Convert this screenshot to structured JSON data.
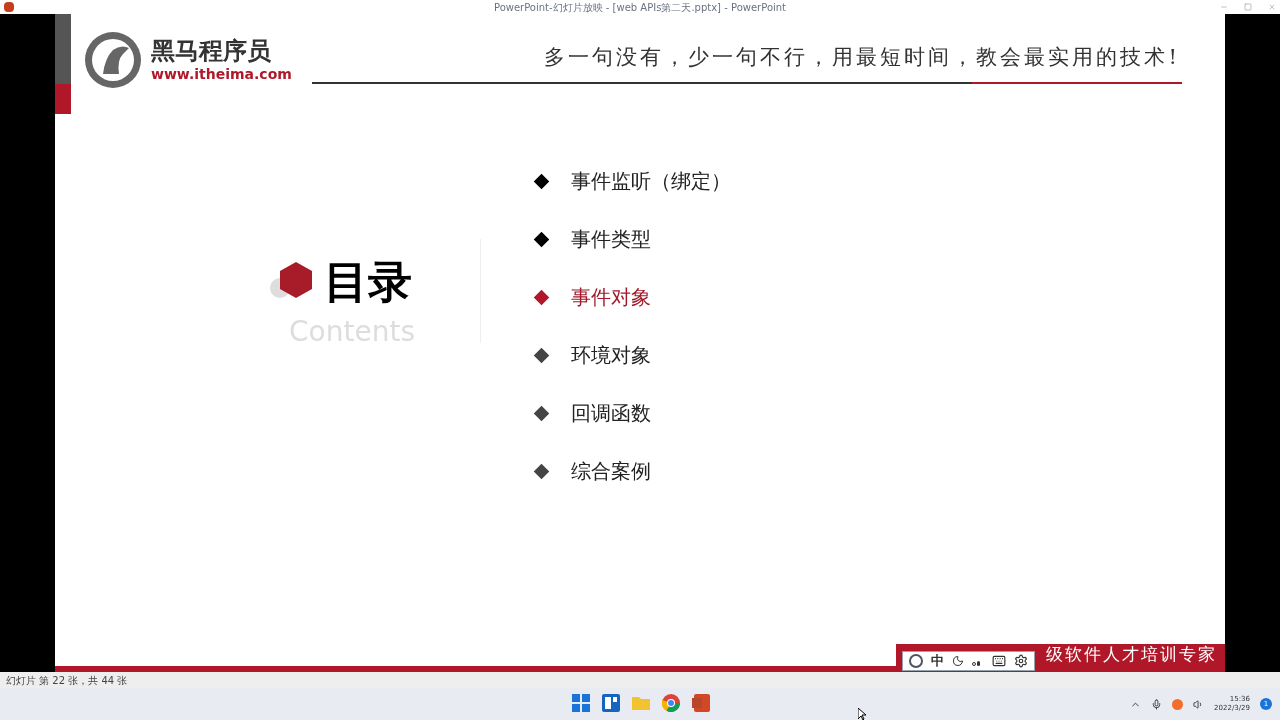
{
  "window": {
    "title": "PowerPoint-幻灯片放映 - [web APIs第二天.pptx] - PowerPoint"
  },
  "slide": {
    "logo": {
      "name": "黑马程序员",
      "url": "www.itheima.com"
    },
    "slogan": "多一句没有，少一句不行，用最短时间，教会最实用的技术!",
    "heading": "目录",
    "subheading": "Contents",
    "items": [
      {
        "label": "事件监听（绑定）",
        "selected": false
      },
      {
        "label": "事件类型",
        "selected": false
      },
      {
        "label": "事件对象",
        "selected": true
      },
      {
        "label": "环境对象",
        "selected": false
      },
      {
        "label": "回调函数",
        "selected": false
      },
      {
        "label": "综合案例",
        "selected": false
      }
    ],
    "footer_tag": "级软件人才培训专家"
  },
  "ime_bar": {
    "mode": "中"
  },
  "status_bar": {
    "text": "幻灯片 第 22 张，共 44 张"
  },
  "taskbar": {
    "time": "15:36",
    "date": "2022/3/29",
    "notifications": "1"
  }
}
